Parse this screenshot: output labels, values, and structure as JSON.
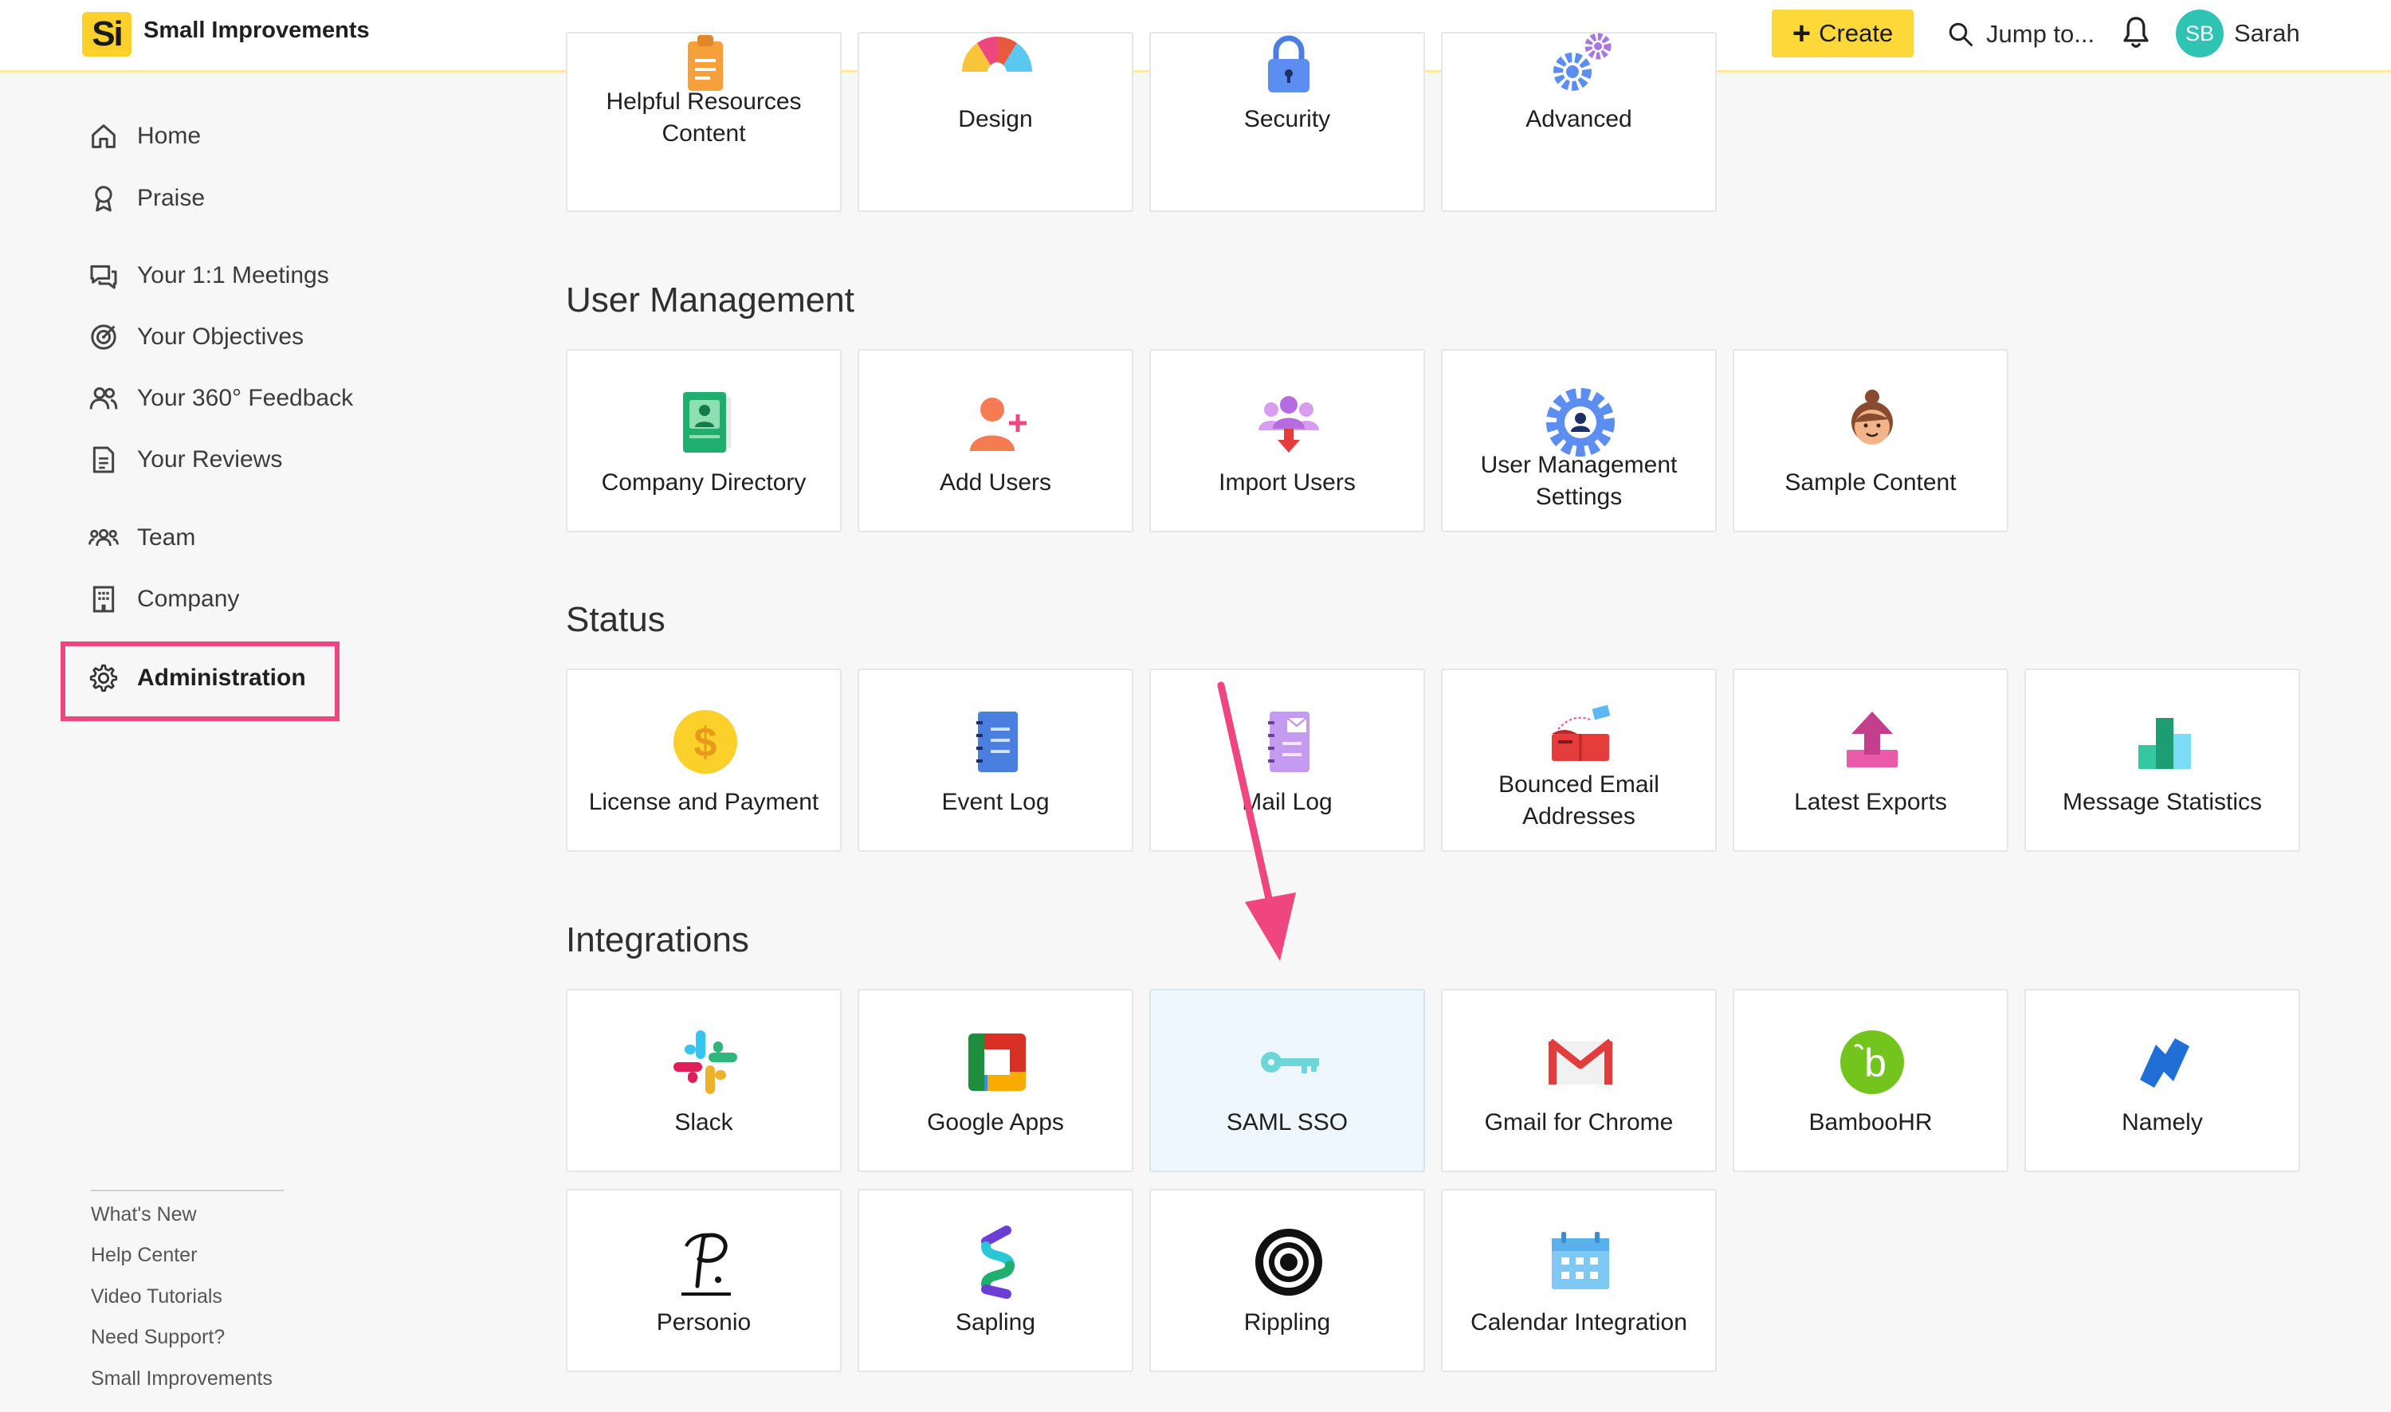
{
  "app": {
    "logo": "Si",
    "name": "Small Improvements"
  },
  "header": {
    "create_label": "Create",
    "jump_label": "Jump to...",
    "user_initials": "SB",
    "user_name": "Sarah"
  },
  "sidebar": {
    "items": [
      {
        "label": "Home",
        "icon": "home-icon"
      },
      {
        "label": "Praise",
        "icon": "ribbon-icon"
      },
      {
        "label": "Your 1:1 Meetings",
        "icon": "chat-icon"
      },
      {
        "label": "Your Objectives",
        "icon": "target-icon"
      },
      {
        "label": "Your 360° Feedback",
        "icon": "people-icon"
      },
      {
        "label": "Your Reviews",
        "icon": "document-icon"
      },
      {
        "label": "Team",
        "icon": "team-icon"
      },
      {
        "label": "Company",
        "icon": "building-icon"
      },
      {
        "label": "Administration",
        "icon": "gear-icon"
      }
    ],
    "footer": [
      "What's New",
      "Help Center",
      "Video Tutorials",
      "Need Support?",
      "Small Improvements"
    ]
  },
  "top_cards": [
    "Helpful Resources Content",
    "Design",
    "Security",
    "Advanced"
  ],
  "sections": {
    "user_management": {
      "title": "User Management",
      "cards": [
        "Company Directory",
        "Add Users",
        "Import Users",
        "User Management Settings",
        "Sample Content"
      ]
    },
    "status": {
      "title": "Status",
      "cards": [
        "License and Payment",
        "Event Log",
        "Mail Log",
        "Bounced Email Addresses",
        "Latest Exports",
        "Message Statistics"
      ]
    },
    "integrations": {
      "title": "Integrations",
      "cards": [
        "Slack",
        "Google Apps",
        "SAML SSO",
        "Gmail for Chrome",
        "BambooHR",
        "Namely",
        "Personio",
        "Sapling",
        "Rippling",
        "Calendar Integration"
      ]
    }
  },
  "colors": {
    "accent": "#fcd839",
    "highlight": "#f0467f",
    "avatar": "#2ec3b3"
  }
}
